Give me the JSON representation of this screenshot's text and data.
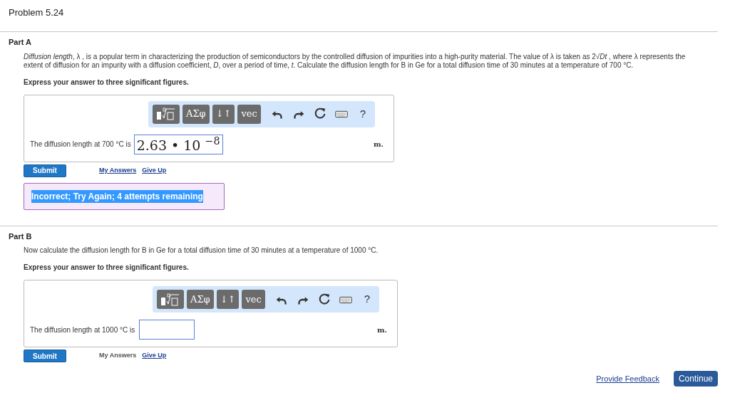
{
  "title": "Problem 5.24",
  "parts": [
    {
      "label": "Part A",
      "paragraphs": [
        "*Diffusion length*, λ , is a popular term in characterizing the production of semiconductors by the controlled diffusion of impurities into a high-purity material. The value of λ is taken as 2√*Dt* , where λ represents the extent of diffusion for an impurity with a diffusion coefficient, *D*, over a period of time, *t*. Calculate the diffusion length for B in Ge for a total diffusion time of 30 minutes at a temperature of 700 °C."
      ],
      "instruction": "Express your answer to three significant figures.",
      "toolbar": {
        "buttons": [
          "ΑΣφ",
          "↓↑",
          "vec"
        ],
        "help": "?"
      },
      "prompt": "The diffusion length at 700 °C is",
      "value": "2.63 • 10 $^{−8}$",
      "unit": "m.",
      "submit": "Submit",
      "my_answers": {
        "label": "My Answers",
        "disabled": false
      },
      "give_up": "Give Up",
      "feedback": "Incorrect; Try Again; 4 attempts remaining"
    },
    {
      "label": "Part B",
      "paragraphs": [
        "Now calculate the diffusion length for B in Ge for a total diffusion time of 30 minutes at a temperature of 1000 °C."
      ],
      "instruction": "Express your answer to three significant figures.",
      "toolbar": {
        "buttons": [
          "ΑΣφ",
          "↓↑",
          "vec"
        ],
        "help": "?"
      },
      "prompt": "The diffusion length at 1000 °C is",
      "unit": "m.",
      "submit": "Submit",
      "my_answers": {
        "label": "My Answers",
        "disabled": true
      },
      "give_up": "Give Up"
    }
  ],
  "footer": {
    "feedback_link": "Provide Feedback",
    "continue": "Continue"
  }
}
